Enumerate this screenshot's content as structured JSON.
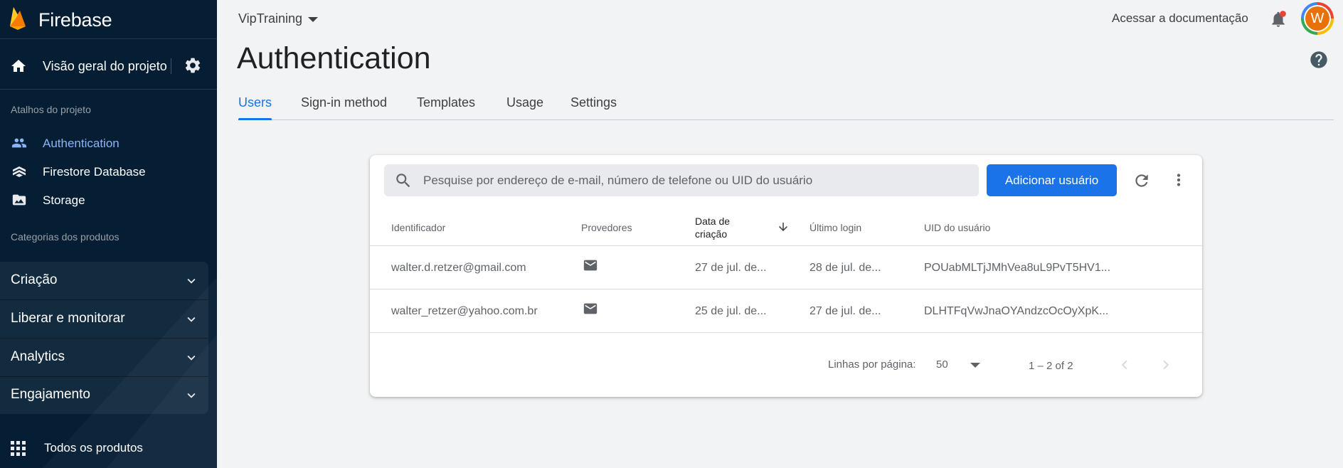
{
  "colors": {
    "sidebar_bg": "#051e34",
    "accent": "#1a73e8",
    "active_nav": "#8ab4f8",
    "page_bg": "#f1f3f4",
    "notification": "#ea4335",
    "avatar": "#e8710a"
  },
  "sidebar": {
    "brand": "Firebase",
    "overview_label": "Visão geral do projeto",
    "shortcuts_title": "Atalhos do projeto",
    "shortcuts": [
      {
        "label": "Authentication",
        "icon": "people-icon",
        "active": true
      },
      {
        "label": "Firestore Database",
        "icon": "firestore-icon",
        "active": false
      },
      {
        "label": "Storage",
        "icon": "image-folder-icon",
        "active": false
      }
    ],
    "categories_title": "Categorias dos produtos",
    "categories": [
      {
        "label": "Criação"
      },
      {
        "label": "Liberar e monitorar"
      },
      {
        "label": "Analytics"
      },
      {
        "label": "Engajamento"
      }
    ],
    "all_products": "Todos os produtos"
  },
  "header": {
    "project_name": "VipTraining",
    "docs_link": "Acessar a documentação",
    "avatar_initial": "W",
    "page_title": "Authentication"
  },
  "tabs": [
    {
      "label": "Users",
      "active": true
    },
    {
      "label": "Sign-in method",
      "active": false
    },
    {
      "label": "Templates",
      "active": false
    },
    {
      "label": "Usage",
      "active": false
    },
    {
      "label": "Settings",
      "active": false
    }
  ],
  "users": {
    "search_placeholder": "Pesquise por endereço de e-mail, número de telefone ou UID do usuário",
    "add_button": "Adicionar usuário",
    "columns": {
      "identifier": "Identificador",
      "providers": "Provedores",
      "created_line1": "Data de",
      "created_line2": "criação",
      "last_login": "Último login",
      "uid": "UID do usuário"
    },
    "rows": [
      {
        "identifier": "walter.d.retzer@gmail.com",
        "provider_icon": "email-icon",
        "created": "27 de jul. de...",
        "last_login": "28 de jul. de...",
        "uid": "POUabMLTjJMhVea8uL9PvT5HV1..."
      },
      {
        "identifier": "walter_retzer@yahoo.com.br",
        "provider_icon": "email-icon",
        "created": "25 de jul. de...",
        "last_login": "27 de jul. de...",
        "uid": "DLHTFqVwJnaOYAndzcOcOyXpK..."
      }
    ],
    "pagination": {
      "rows_per_page_label": "Linhas por página:",
      "rows_per_page": "50",
      "range": "1 – 2 of 2"
    }
  }
}
